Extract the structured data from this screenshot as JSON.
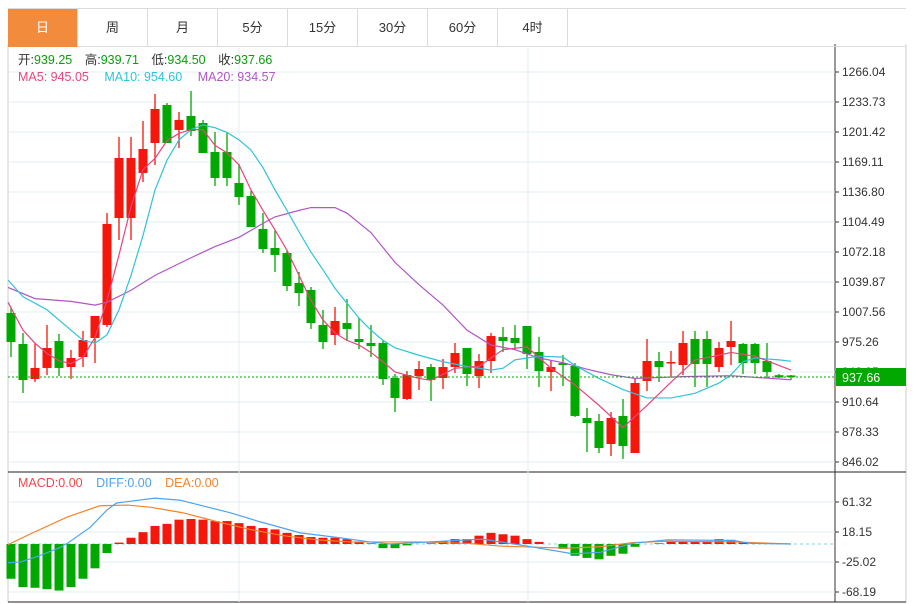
{
  "tabs": [
    {
      "label": "日",
      "active": true
    },
    {
      "label": "周"
    },
    {
      "label": "月"
    },
    {
      "label": "5分"
    },
    {
      "label": "15分"
    },
    {
      "label": "30分"
    },
    {
      "label": "60分"
    },
    {
      "label": "4时"
    }
  ],
  "info": {
    "open_label": "开:",
    "open": "939.25",
    "high_label": "高:",
    "high": "939.71",
    "low_label": "低:",
    "low": "934.50",
    "close_label": "收:",
    "close": "937.66",
    "ma5": "MA5: 945.05",
    "ma10": "MA10: 954.60",
    "ma20": "MA20: 934.57"
  },
  "macd_info": {
    "macd": "MACD:0.00",
    "diff": "DIFF:0.00",
    "dea": "DEA:0.00"
  },
  "colors": {
    "up": "#f5160c",
    "down": "#00a800",
    "ma5": "#e8457a",
    "ma10": "#2fc3d8",
    "ma20": "#b055c8",
    "diff": "#4da3f0",
    "dea": "#f5832a",
    "active_tab": "#f28b3c"
  },
  "current_price": "937.66",
  "chart_data": [
    {
      "type": "candlestick",
      "price_axis_ticks": [
        "1266.04",
        "1233.73",
        "1201.42",
        "1169.11",
        "1136.80",
        "1104.49",
        "1072.18",
        "1039.87",
        "1007.56",
        "975.26",
        "942.95",
        "910.64",
        "878.33",
        "846.02"
      ],
      "ylim": [
        846.02,
        1266.04
      ],
      "ohlc": [
        [
          1006.5,
          975.3,
          1013.0,
          959.1
        ],
        [
          973.1,
          934.3,
          985.0,
          920.3
        ],
        [
          935.4,
          947.3,
          974.2,
          932.2
        ],
        [
          947.3,
          968.8,
          993.6,
          939.7
        ],
        [
          976.3,
          947.3,
          983.9,
          938.6
        ],
        [
          948.3,
          958.0,
          966.6,
          935.4
        ],
        [
          959.1,
          977.4,
          987.1,
          948.3
        ],
        [
          979.6,
          1003.3,
          1003.3,
          952.6
        ],
        [
          993.6,
          1102.4,
          1114.2,
          991.4
        ],
        [
          1108.8,
          1173.4,
          1196.1,
          1085.1
        ],
        [
          1108.8,
          1173.4,
          1196.1,
          1085.1
        ],
        [
          1157.3,
          1183.1,
          1213.3,
          1147.6
        ],
        [
          1189.6,
          1226.2,
          1242.4,
          1165.9
        ],
        [
          1230.5,
          1189.6,
          1232.7,
          1189.6
        ],
        [
          1203.6,
          1214.4,
          1223.0,
          1184.2
        ],
        [
          1218.7,
          1202.5,
          1245.6,
          1197.1
        ],
        [
          1211.1,
          1178.8,
          1214.4,
          1178.8
        ],
        [
          1179.9,
          1151.9,
          1201.4,
          1143.3
        ],
        [
          1179.9,
          1151.9,
          1201.4,
          1143.3
        ],
        [
          1146.5,
          1131.4,
          1167.0,
          1122.8
        ],
        [
          1132.5,
          1099.1,
          1137.9,
          1099.1
        ],
        [
          1097.0,
          1075.4,
          1114.2,
          1071.1
        ],
        [
          1076.5,
          1069.0,
          1095.9,
          1050.7
        ],
        [
          1071.1,
          1035.6,
          1074.3,
          1030.2
        ],
        [
          1038.8,
          1028.0,
          1050.7,
          1014.0
        ],
        [
          1031.3,
          995.7,
          1034.5,
          989.3
        ],
        [
          993.6,
          975.3,
          1009.7,
          967.7
        ],
        [
          982.8,
          997.9,
          1013.0,
          972.0
        ],
        [
          995.7,
          989.3,
          1021.6,
          976.3
        ],
        [
          978.5,
          975.3,
          1001.1,
          967.7
        ],
        [
          974.2,
          971.0,
          993.6,
          959.1
        ],
        [
          974.2,
          935.4,
          977.4,
          929.0
        ],
        [
          936.5,
          915.0,
          940.8,
          899.9
        ],
        [
          913.9,
          939.7,
          944.0,
          912.8
        ],
        [
          938.6,
          946.2,
          954.8,
          923.6
        ],
        [
          948.3,
          934.3,
          951.6,
          911.7
        ],
        [
          936.5,
          948.3,
          957.0,
          924.6
        ],
        [
          948.3,
          963.4,
          974.2,
          941.9
        ],
        [
          968.8,
          940.8,
          968.8,
          927.9
        ],
        [
          938.6,
          954.8,
          962.3,
          925.7
        ],
        [
          954.8,
          981.7,
          985.0,
          941.9
        ],
        [
          980.7,
          976.3,
          991.4,
          964.5
        ],
        [
          979.6,
          974.2,
          993.6,
          966.6
        ],
        [
          992.5,
          962.3,
          992.5,
          946.2
        ],
        [
          964.5,
          944.0,
          980.7,
          926.8
        ],
        [
          943.0,
          948.3,
          955.9,
          922.5
        ],
        [
          952.6,
          950.5,
          961.3,
          927.9
        ],
        [
          949.4,
          895.6,
          952.6,
          894.5
        ],
        [
          893.4,
          888.0,
          904.2,
          856.8
        ],
        [
          890.2,
          861.1,
          897.7,
          855.7
        ],
        [
          865.4,
          893.4,
          899.9,
          852.5
        ],
        [
          895.6,
          863.3,
          913.9,
          849.3
        ],
        [
          855.7,
          931.1,
          936.5,
          855.7
        ],
        [
          933.3,
          954.8,
          978.5,
          922.5
        ],
        [
          954.8,
          948.3,
          964.5,
          932.2
        ],
        [
          952.6,
          953.7,
          965.6,
          937.6
        ],
        [
          950.5,
          974.2,
          987.1,
          939.7
        ],
        [
          978.5,
          951.6,
          987.1,
          926.8
        ],
        [
          978.5,
          951.6,
          987.1,
          926.8
        ],
        [
          948.3,
          968.8,
          975.3,
          943.0
        ],
        [
          969.9,
          976.3,
          997.9,
          950.5
        ],
        [
          973.1,
          952.6,
          974.2,
          940.8
        ],
        [
          973.1,
          952.6,
          974.2,
          940.8
        ],
        [
          954.8,
          943.0,
          974.2,
          936.5
        ],
        [
          939.5,
          937.0,
          940.8,
          936.5
        ],
        [
          939.25,
          937.66,
          939.71,
          934.5
        ]
      ],
      "ma5": [
        [
          -0.25,
          1018
        ],
        [
          1,
          988
        ],
        [
          2,
          974
        ],
        [
          3,
          963
        ],
        [
          4,
          955
        ],
        [
          5,
          952
        ],
        [
          6,
          959
        ],
        [
          7,
          980
        ],
        [
          8,
          1020
        ],
        [
          9,
          1069
        ],
        [
          10,
          1121
        ],
        [
          11,
          1161
        ],
        [
          12,
          1173
        ],
        [
          13,
          1192
        ],
        [
          14,
          1200
        ],
        [
          15,
          1204
        ],
        [
          16,
          1204
        ],
        [
          17,
          1187
        ],
        [
          18,
          1179
        ],
        [
          19,
          1166
        ],
        [
          20,
          1139
        ],
        [
          21,
          1117
        ],
        [
          22,
          1096
        ],
        [
          23,
          1074
        ],
        [
          24,
          1047
        ],
        [
          25,
          1020
        ],
        [
          26,
          999
        ],
        [
          27,
          985
        ],
        [
          28,
          977
        ],
        [
          29,
          972
        ],
        [
          30,
          964
        ],
        [
          31,
          954
        ],
        [
          32,
          943
        ],
        [
          34,
          936
        ],
        [
          35,
          934
        ],
        [
          37,
          947
        ],
        [
          39,
          949
        ],
        [
          41,
          967
        ],
        [
          43,
          970
        ],
        [
          45,
          947
        ],
        [
          47,
          929
        ],
        [
          49,
          907
        ],
        [
          51,
          883
        ],
        [
          53,
          907
        ],
        [
          55,
          932
        ],
        [
          57,
          956
        ],
        [
          59,
          961
        ],
        [
          60,
          964
        ],
        [
          62,
          960
        ],
        [
          64,
          950
        ],
        [
          65,
          945.05
        ]
      ],
      "ma10": [
        [
          -0.25,
          1042
        ],
        [
          1,
          1024
        ],
        [
          3,
          1010
        ],
        [
          5,
          988
        ],
        [
          6,
          977
        ],
        [
          7,
          974
        ],
        [
          8,
          983
        ],
        [
          9,
          1010
        ],
        [
          10,
          1047
        ],
        [
          11,
          1090
        ],
        [
          12,
          1139
        ],
        [
          13,
          1171
        ],
        [
          14,
          1193
        ],
        [
          15,
          1204
        ],
        [
          16,
          1209
        ],
        [
          17,
          1206
        ],
        [
          18,
          1201
        ],
        [
          19,
          1193
        ],
        [
          20,
          1182
        ],
        [
          21,
          1163
        ],
        [
          22,
          1139
        ],
        [
          23,
          1117
        ],
        [
          24,
          1094
        ],
        [
          25,
          1072
        ],
        [
          26,
          1053
        ],
        [
          27,
          1033
        ],
        [
          28,
          1017
        ],
        [
          29,
          1001
        ],
        [
          30,
          988
        ],
        [
          31,
          977
        ],
        [
          32,
          969
        ],
        [
          34,
          961
        ],
        [
          36,
          954
        ],
        [
          38,
          949
        ],
        [
          40,
          945
        ],
        [
          41,
          947
        ],
        [
          42,
          956
        ],
        [
          44,
          960
        ],
        [
          46,
          959
        ],
        [
          47,
          950
        ],
        [
          49,
          936
        ],
        [
          51,
          924
        ],
        [
          53,
          915
        ],
        [
          55,
          915
        ],
        [
          57,
          920
        ],
        [
          59,
          931
        ],
        [
          60,
          940
        ],
        [
          61,
          954
        ],
        [
          62,
          958
        ],
        [
          64,
          956
        ],
        [
          65,
          954.6
        ]
      ],
      "ma20": [
        [
          -0.25,
          1034
        ],
        [
          2,
          1022
        ],
        [
          5,
          1019
        ],
        [
          7,
          1015
        ],
        [
          8,
          1018
        ],
        [
          10,
          1031
        ],
        [
          12,
          1047
        ],
        [
          15,
          1066
        ],
        [
          17,
          1078
        ],
        [
          19,
          1088
        ],
        [
          21,
          1103
        ],
        [
          22,
          1110
        ],
        [
          24,
          1117
        ],
        [
          25,
          1120
        ],
        [
          27,
          1120
        ],
        [
          28,
          1114
        ],
        [
          30,
          1093
        ],
        [
          32,
          1061
        ],
        [
          34,
          1037
        ],
        [
          36,
          1015
        ],
        [
          38,
          988
        ],
        [
          40,
          972
        ],
        [
          42,
          967
        ],
        [
          44,
          958
        ],
        [
          46,
          953
        ],
        [
          48,
          946
        ],
        [
          50,
          940
        ],
        [
          52,
          936
        ],
        [
          56,
          938
        ],
        [
          60,
          939
        ],
        [
          65,
          934.57
        ]
      ]
    },
    {
      "type": "bar",
      "title": "MACD",
      "axis_ticks": [
        "61.32",
        "18.15",
        "-25.02",
        "-68.19"
      ],
      "ylim": [
        -68.19,
        61.32
      ],
      "macd": [
        -50,
        -62,
        -63,
        -65,
        -67,
        -62,
        -50,
        -35,
        -13,
        2,
        9,
        17,
        26,
        29,
        35,
        36,
        35,
        33,
        33,
        30,
        26,
        23,
        21,
        16,
        13,
        10,
        9,
        9,
        7,
        3,
        1,
        -6,
        -6,
        -2,
        0,
        1,
        4,
        7,
        7,
        12,
        16,
        14,
        12,
        7,
        3,
        0,
        -7,
        -17,
        -20,
        -22,
        -17,
        -14,
        -4,
        0,
        1,
        4,
        4,
        3,
        4,
        7,
        6,
        2,
        1,
        0,
        0,
        0
      ],
      "diff": [
        [
          -0.25,
          -27
        ],
        [
          0.75,
          -26
        ],
        [
          2.2,
          -18
        ],
        [
          4.1,
          -5
        ],
        [
          4.7,
          1
        ],
        [
          6.6,
          24
        ],
        [
          8,
          49
        ],
        [
          8.8,
          59
        ],
        [
          12,
          66
        ],
        [
          14.1,
          63
        ],
        [
          18.25,
          45
        ],
        [
          20.75,
          32
        ],
        [
          24.1,
          16
        ],
        [
          27.4,
          9
        ],
        [
          29.9,
          3
        ],
        [
          31.6,
          0
        ],
        [
          39.3,
          7
        ],
        [
          43,
          -3
        ],
        [
          46.8,
          -14
        ],
        [
          49.1,
          -12
        ],
        [
          51.8,
          1
        ],
        [
          54.7,
          6
        ],
        [
          60.2,
          5
        ],
        [
          61.6,
          1
        ],
        [
          65,
          0
        ]
      ],
      "dea": [
        [
          -0.25,
          -1
        ],
        [
          1.8,
          16
        ],
        [
          4.7,
          39
        ],
        [
          7.4,
          55
        ],
        [
          9.7,
          56
        ],
        [
          11.6,
          53
        ],
        [
          14.3,
          45
        ],
        [
          17.2,
          32
        ],
        [
          19.9,
          21
        ],
        [
          22.7,
          12
        ],
        [
          25.5,
          6
        ],
        [
          28.25,
          3
        ],
        [
          33.8,
          3
        ],
        [
          38,
          1
        ],
        [
          40.75,
          -3
        ],
        [
          46.3,
          -6
        ],
        [
          49.1,
          -4
        ],
        [
          51.8,
          2
        ],
        [
          54.7,
          4
        ],
        [
          60.2,
          3
        ],
        [
          65,
          0
        ]
      ]
    }
  ]
}
